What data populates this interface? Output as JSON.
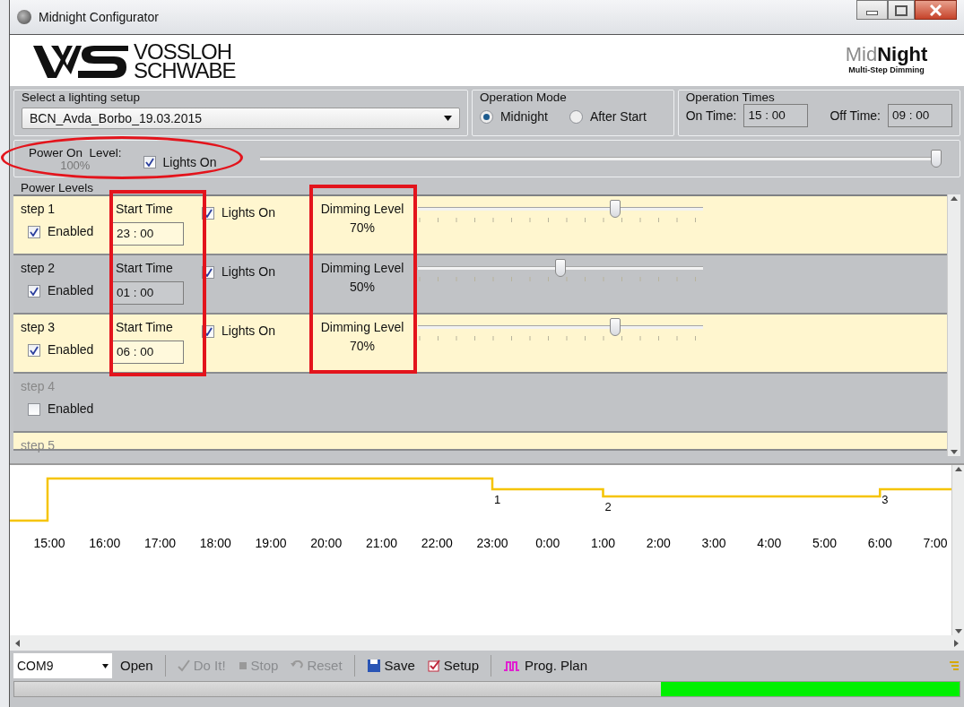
{
  "window": {
    "title": "Midnight Configurator"
  },
  "brand": {
    "line1": "VOSSLOH",
    "line2": "SCHWABE"
  },
  "product_logo": {
    "name_light": "Mid",
    "name_bold": "Night",
    "tagline": "Multi-Step Dimming"
  },
  "setup": {
    "label": "Select a lighting setup",
    "value": "BCN_Avda_Borbo_19.03.2015"
  },
  "operation_mode": {
    "label": "Operation Mode",
    "options": [
      {
        "label": "Midnight",
        "selected": true
      },
      {
        "label": "After Start",
        "selected": false
      }
    ]
  },
  "operation_times": {
    "label": "Operation Times",
    "on_label": "On Time:",
    "on_value": "15 : 00",
    "off_label": "Off Time:",
    "off_value": "09 : 00"
  },
  "power_on": {
    "label": "Power On  Level:",
    "reading": "100%",
    "lights_on_label": "Lights On",
    "lights_on": true,
    "level": 1
  },
  "power_levels": {
    "label": "Power Levels",
    "steps": [
      {
        "name": "step 1",
        "enabled_label": "Enabled",
        "enabled": true,
        "start_label": "Start Time",
        "start_time": "23 : 00",
        "lights_on_label": "Lights On",
        "lights_on": true,
        "dimming_label": "Dimming Level",
        "reading": "70%",
        "level": 0.7
      },
      {
        "name": "step 2",
        "enabled_label": "Enabled",
        "enabled": true,
        "start_label": "Start Time",
        "start_time": "01 : 00",
        "lights_on_label": "Lights On",
        "lights_on": true,
        "dimming_label": "Dimming Level",
        "reading": "50%",
        "level": 0.5
      },
      {
        "name": "step 3",
        "enabled_label": "Enabled",
        "enabled": true,
        "start_label": "Start Time",
        "start_time": "06 : 00",
        "lights_on_label": "Lights On",
        "lights_on": true,
        "dimming_label": "Dimming Level",
        "reading": "70%",
        "level": 0.7
      },
      {
        "name": "step 4",
        "enabled_label": "Enabled",
        "enabled": false
      },
      {
        "name": "step 5"
      }
    ]
  },
  "timeline": {
    "hours": [
      "15:00",
      "16:00",
      "17:00",
      "18:00",
      "19:00",
      "20:00",
      "21:00",
      "22:00",
      "23:00",
      "0:00",
      "1:00",
      "2:00",
      "3:00",
      "4:00",
      "5:00",
      "6:00",
      "7:00"
    ],
    "markers": [
      "1",
      "2",
      "3"
    ]
  },
  "toolbar": {
    "port": "COM9",
    "buttons": [
      {
        "kind": "plain",
        "label": "Open",
        "disabled": false
      },
      {
        "kind": "sep"
      },
      {
        "kind": "check",
        "label": "Do It!",
        "disabled": true
      },
      {
        "kind": "stop",
        "label": "Stop",
        "disabled": true
      },
      {
        "kind": "undo",
        "label": "Reset",
        "disabled": true
      },
      {
        "kind": "sep"
      },
      {
        "kind": "disk",
        "label": "Save",
        "disabled": false
      },
      {
        "kind": "setup",
        "label": "Setup",
        "disabled": false
      },
      {
        "kind": "sep"
      },
      {
        "kind": "plan",
        "label": "Prog. Plan",
        "disabled": false
      }
    ]
  }
}
